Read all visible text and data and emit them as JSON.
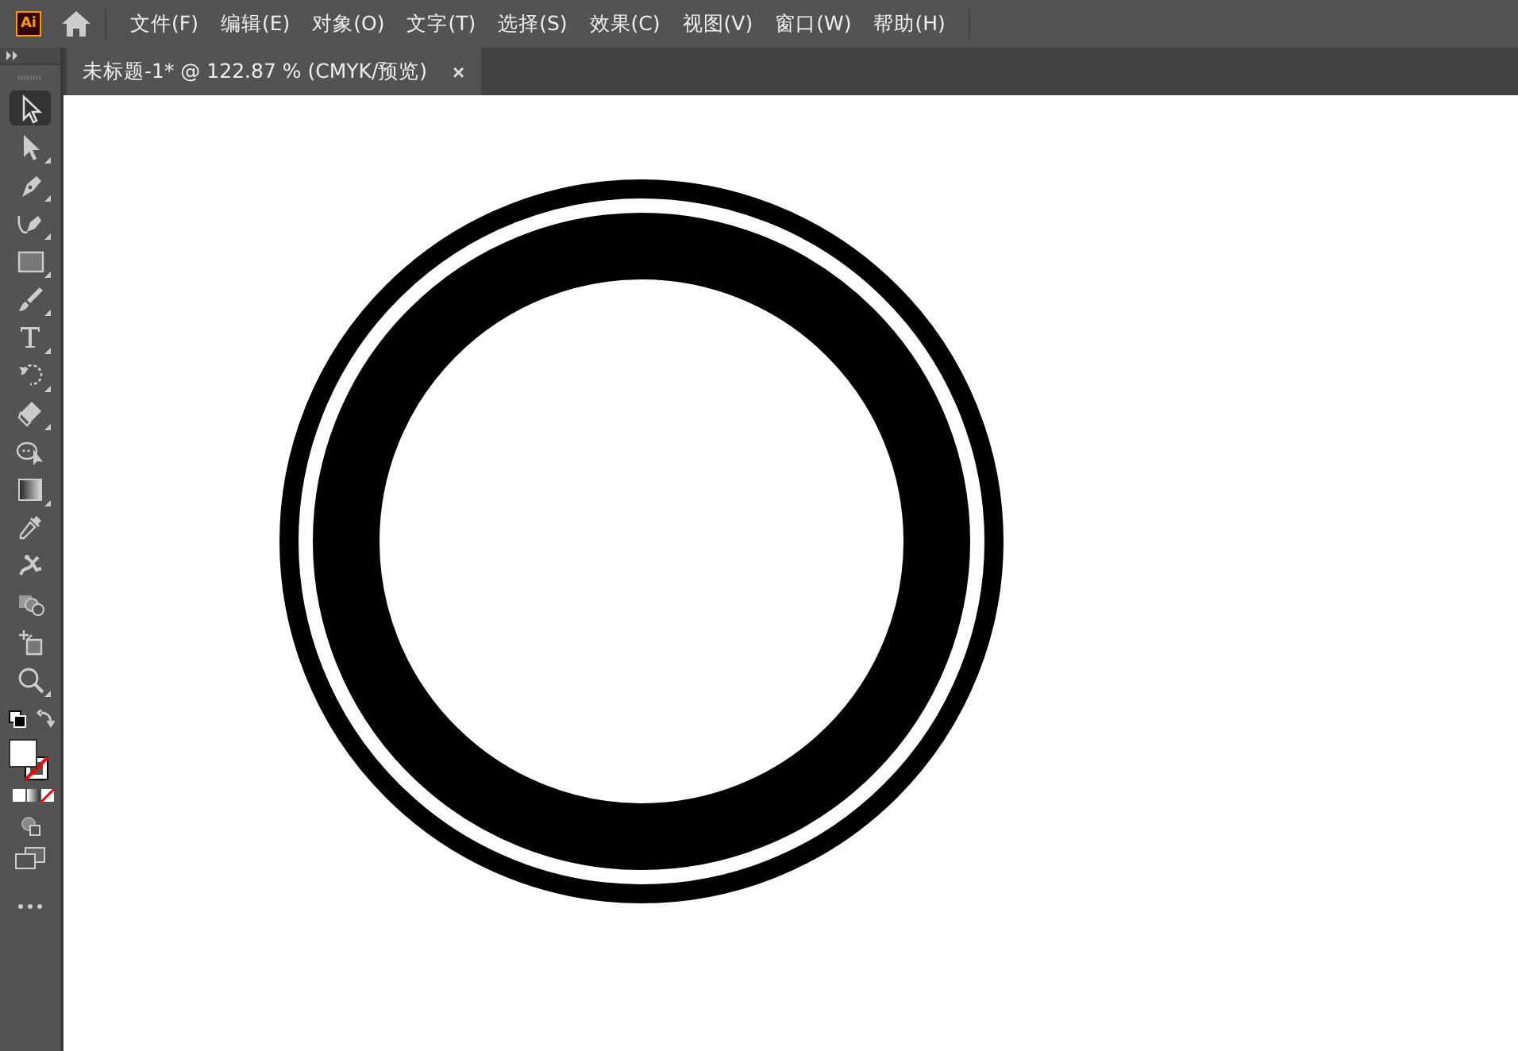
{
  "app_logo": "Ai",
  "menu": [
    "文件(F)",
    "编辑(E)",
    "对象(O)",
    "文字(T)",
    "选择(S)",
    "效果(C)",
    "视图(V)",
    "窗口(W)",
    "帮助(H)"
  ],
  "document_tab": {
    "title": "未标题-1* @ 122.87 % (CMYK/预览)",
    "close": "×",
    "selected": true
  },
  "tools": [
    {
      "kind": "selection",
      "selected": true,
      "flyout": false
    },
    {
      "kind": "direct-selection",
      "selected": false,
      "flyout": true
    },
    {
      "kind": "pen",
      "selected": false,
      "flyout": true
    },
    {
      "kind": "curvature",
      "selected": false,
      "flyout": true
    },
    {
      "kind": "rectangle",
      "selected": false,
      "flyout": true
    },
    {
      "kind": "brush",
      "selected": false,
      "flyout": true
    },
    {
      "kind": "type",
      "selected": false,
      "flyout": true
    },
    {
      "kind": "rotate",
      "selected": false,
      "flyout": true
    },
    {
      "kind": "eraser",
      "selected": false,
      "flyout": true
    },
    {
      "kind": "shape-builder",
      "selected": false,
      "flyout": false
    },
    {
      "kind": "gradient",
      "selected": false,
      "flyout": true
    },
    {
      "kind": "eyedropper",
      "selected": false,
      "flyout": false
    },
    {
      "kind": "puppet",
      "selected": false,
      "flyout": false
    },
    {
      "kind": "shapes",
      "selected": false,
      "flyout": false
    },
    {
      "kind": "artboard",
      "selected": false,
      "flyout": false
    },
    {
      "kind": "zoom",
      "selected": false,
      "flyout": true
    }
  ]
}
